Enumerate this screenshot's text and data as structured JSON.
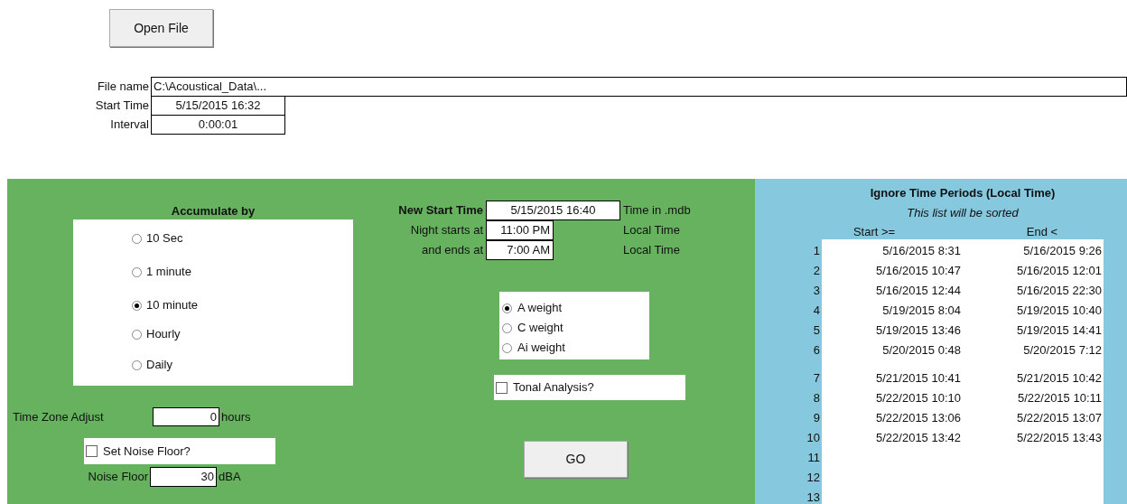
{
  "open_file_button": "Open File",
  "file_info": [
    {
      "label": "File name",
      "value": "C:\\Acoustical_Data\\...",
      "kind": "wide"
    },
    {
      "label": "Start Time",
      "value": "5/15/2015 16:32",
      "kind": "short"
    },
    {
      "label": "Interval",
      "value": "0:00:01",
      "kind": "short"
    }
  ],
  "accumulate": {
    "title": "Accumulate by",
    "options": [
      {
        "label": "10 Sec",
        "selected": false
      },
      {
        "label": "1 minute",
        "selected": false
      },
      {
        "label": "10 minute",
        "selected": true
      },
      {
        "label": "Hourly",
        "selected": false
      },
      {
        "label": "Daily",
        "selected": false
      }
    ]
  },
  "time_zone": {
    "label": "Time Zone Adjust",
    "value": "0",
    "unit": "hours"
  },
  "noise_floor_checkbox": {
    "label": "Set Noise Floor?",
    "checked": false
  },
  "noise_floor": {
    "label": "Noise Floor",
    "value": "30",
    "unit": "dBA"
  },
  "times": [
    {
      "label": "New Start Time",
      "value": "5/15/2015 16:40",
      "note": "Time in .mdb",
      "kind": "wide"
    },
    {
      "label": "Night starts at",
      "value": "11:00 PM",
      "note": "Local Time",
      "kind": "short"
    },
    {
      "label": "and ends at",
      "value": "7:00 AM",
      "note": "Local Time",
      "kind": "short"
    }
  ],
  "weighting": [
    {
      "label": "A weight",
      "selected": true
    },
    {
      "label": "C weight",
      "selected": false
    },
    {
      "label": "Ai weight",
      "selected": false
    }
  ],
  "tonal_checkbox": {
    "label": "Tonal Analysis?",
    "checked": false
  },
  "go_button": "GO",
  "ignore_periods": {
    "title": "Ignore Time Periods (Local Time)",
    "subtitle": "This list will be sorted",
    "columns": [
      "Start >=",
      "End <"
    ],
    "rows": [
      {
        "number": "1",
        "start": "5/16/2015 8:31",
        "end": "5/16/2015 9:26"
      },
      {
        "number": "2",
        "start": "5/16/2015 10:47",
        "end": "5/16/2015 12:01"
      },
      {
        "number": "3",
        "start": "5/16/2015 12:44",
        "end": "5/16/2015 22:30"
      },
      {
        "number": "4",
        "start": "5/19/2015 8:04",
        "end": "5/19/2015 10:40"
      },
      {
        "number": "5",
        "start": "5/19/2015 13:46",
        "end": "5/19/2015 14:41"
      },
      {
        "number": "6",
        "start": "5/20/2015 0:48",
        "end": "5/20/2015 7:12"
      },
      {
        "number": "7",
        "start": "5/21/2015 10:41",
        "end": "5/21/2015 10:42"
      },
      {
        "number": "8",
        "start": "5/22/2015 10:10",
        "end": "5/22/2015 10:11"
      },
      {
        "number": "9",
        "start": "5/22/2015 13:06",
        "end": "5/22/2015 13:07"
      },
      {
        "number": "10",
        "start": "5/22/2015 13:42",
        "end": "5/22/2015 13:43"
      },
      {
        "number": "11"
      },
      {
        "number": "12"
      },
      {
        "number": "13"
      }
    ]
  }
}
